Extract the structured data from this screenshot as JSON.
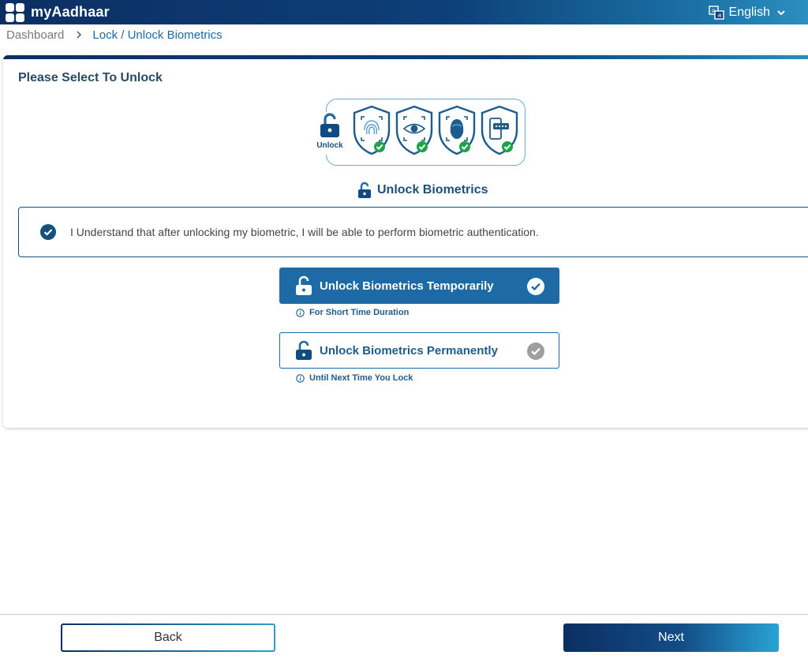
{
  "header": {
    "brand": "myAadhaar",
    "language": "English"
  },
  "icons": {
    "language": "translate-icon",
    "chevron": "chevron-down-icon",
    "logo": "app-grid-logo-icon"
  },
  "breadcrumb": {
    "home": "Dashboard",
    "current": "Lock / Unlock Biometrics"
  },
  "card": {
    "title": "Please Select To Unlock",
    "illustration": {
      "lock_label": "Unlock",
      "shields": [
        "fingerprint-shield-icon",
        "iris-shield-icon",
        "face-shield-icon",
        "otp-device-shield-icon"
      ]
    },
    "section_heading": "Unlock Biometrics",
    "consent": {
      "checked": true,
      "text": "I Understand that after unlocking my biometric, I will be able to perform biometric authentication."
    },
    "options": [
      {
        "label": "Unlock Biometrics Temporarily",
        "note": "For Short Time Duration",
        "selected": true
      },
      {
        "label": "Unlock Biometrics Permanently",
        "note": "Until Next Time You Lock",
        "selected": false
      }
    ]
  },
  "footer": {
    "back_label": "Back",
    "next_label": "Next"
  },
  "colors": {
    "brand_dark": "#0b2f63",
    "brand_blue": "#1d6aa6",
    "accent_light": "#2b9fcf",
    "success": "#1aa34a",
    "check_inactive": "#9e9e9e"
  }
}
